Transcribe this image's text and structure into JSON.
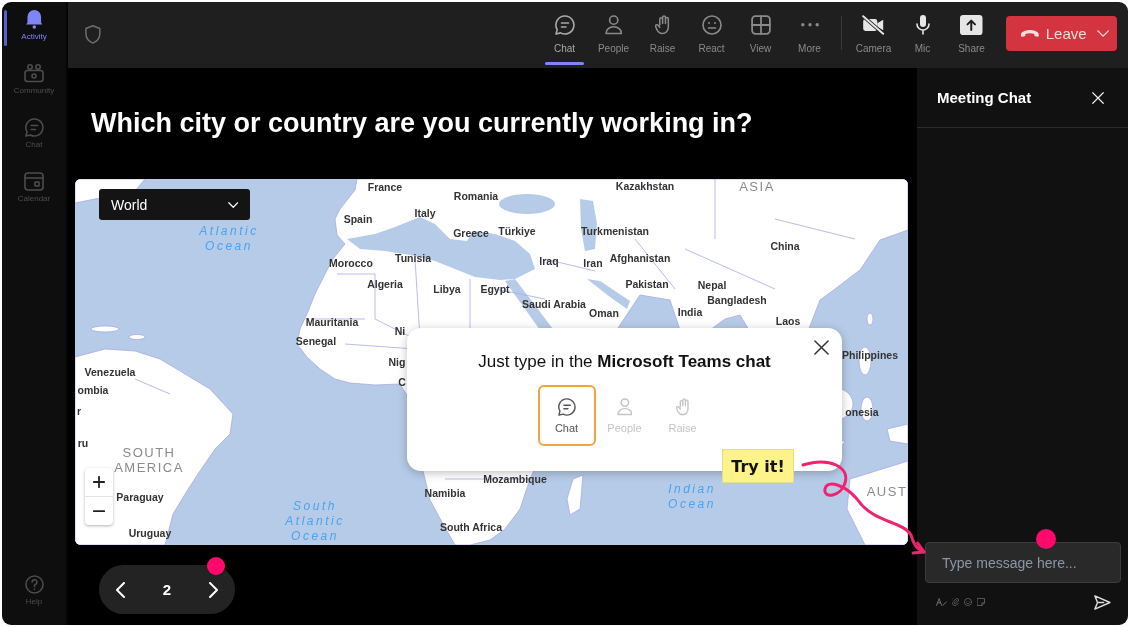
{
  "sidebar": {
    "items": [
      {
        "label": "Activity",
        "selected": true
      },
      {
        "label": "Community",
        "selected": false
      },
      {
        "label": "Chat",
        "selected": false
      },
      {
        "label": "Calendar",
        "selected": false
      }
    ],
    "help": {
      "label": "Help"
    }
  },
  "toolbar": {
    "items": [
      {
        "label": "Chat",
        "selected": true
      },
      {
        "label": "People",
        "selected": false
      },
      {
        "label": "Raise",
        "selected": false
      },
      {
        "label": "React",
        "selected": false
      },
      {
        "label": "View",
        "selected": false
      },
      {
        "label": "More",
        "selected": false
      }
    ],
    "devices": [
      {
        "label": "Camera"
      },
      {
        "label": "Mic"
      },
      {
        "label": "Share"
      }
    ],
    "leave_button": {
      "label": "Leave"
    }
  },
  "question": {
    "title": "Which city or country are you currently working in?"
  },
  "map": {
    "region_dropdown": {
      "value": "World"
    },
    "labels": [
      {
        "text": "France",
        "kind": "country"
      },
      {
        "text": "Kazakhstan",
        "kind": "country"
      },
      {
        "text": "ASIA",
        "kind": "continent"
      },
      {
        "text": "Romania",
        "kind": "country"
      },
      {
        "text": "Spain",
        "kind": "country"
      },
      {
        "text": "Italy",
        "kind": "country"
      },
      {
        "text": "Atlantic Ocean",
        "kind": "ocean"
      },
      {
        "text": "Greece",
        "kind": "country"
      },
      {
        "text": "Türkiye",
        "kind": "country"
      },
      {
        "text": "Turkmenistan",
        "kind": "country"
      },
      {
        "text": "China",
        "kind": "country"
      },
      {
        "text": "Morocco",
        "kind": "country"
      },
      {
        "text": "Tunisia",
        "kind": "country"
      },
      {
        "text": "Iraq",
        "kind": "country"
      },
      {
        "text": "Iran",
        "kind": "country"
      },
      {
        "text": "Afghanistan",
        "kind": "country"
      },
      {
        "text": "Algeria",
        "kind": "country"
      },
      {
        "text": "Libya",
        "kind": "country"
      },
      {
        "text": "Egypt",
        "kind": "country"
      },
      {
        "text": "Pakistan",
        "kind": "country"
      },
      {
        "text": "Nepal",
        "kind": "country"
      },
      {
        "text": "Saudi Arabia",
        "kind": "country"
      },
      {
        "text": "Bangladesh",
        "kind": "country"
      },
      {
        "text": "Oman",
        "kind": "country"
      },
      {
        "text": "India",
        "kind": "country"
      },
      {
        "text": "Mauritania",
        "kind": "country"
      },
      {
        "text": "Laos",
        "kind": "country"
      },
      {
        "text": "Ni",
        "kind": "country"
      },
      {
        "text": "Senegal",
        "kind": "country"
      },
      {
        "text": "Philippines",
        "kind": "country"
      },
      {
        "text": "Nig",
        "kind": "country"
      },
      {
        "text": "Venezuela",
        "kind": "country"
      },
      {
        "text": "C",
        "kind": "country"
      },
      {
        "text": "ombia",
        "kind": "country"
      },
      {
        "text": "r",
        "kind": "country"
      },
      {
        "text": "onesia",
        "kind": "country"
      },
      {
        "text": "ru",
        "kind": "country"
      },
      {
        "text": "SOUTH AMERICA",
        "kind": "continent"
      },
      {
        "text": "Mozambique",
        "kind": "country"
      },
      {
        "text": "Paraguay",
        "kind": "country"
      },
      {
        "text": "Namibia",
        "kind": "country"
      },
      {
        "text": "Indian Ocean",
        "kind": "ocean"
      },
      {
        "text": "AUST",
        "kind": "continent"
      },
      {
        "text": "Uruguay",
        "kind": "country"
      },
      {
        "text": "South Atlantic Ocean",
        "kind": "ocean"
      },
      {
        "text": "South Africa",
        "kind": "country"
      }
    ]
  },
  "tip": {
    "message": "Just type in the **Microsoft Teams chat**",
    "items": [
      {
        "label": "Chat",
        "selected": true
      },
      {
        "label": "People",
        "selected": false
      },
      {
        "label": "Raise",
        "selected": false
      }
    ],
    "sticker": "Try it!"
  },
  "pager": {
    "page": "2"
  },
  "chat_panel": {
    "title": "Meeting Chat",
    "input": {
      "placeholder": "Type message here..."
    }
  }
}
